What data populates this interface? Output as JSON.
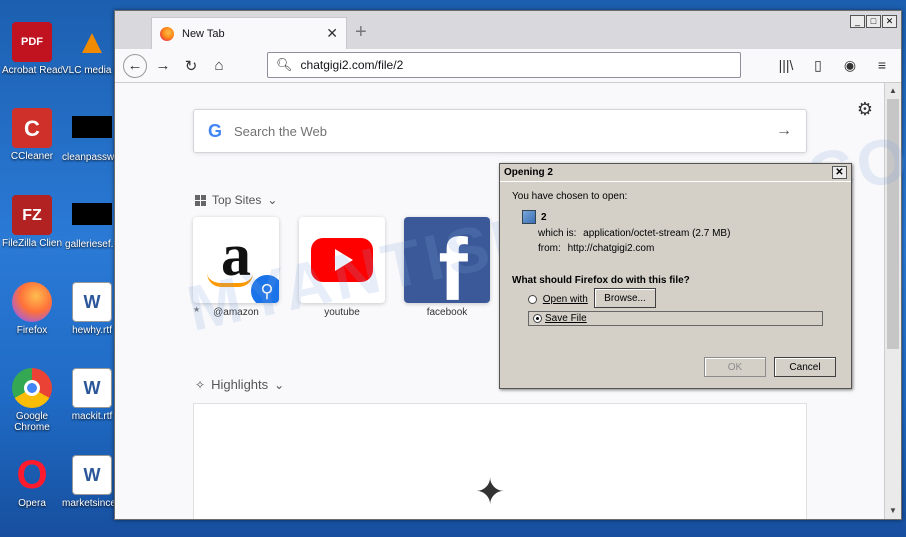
{
  "desktop": {
    "icons": [
      {
        "label": "Acrobat Reader DC",
        "color": "#c1121f",
        "glyph": "PDF"
      },
      {
        "label": "VLC media player",
        "color": "#f08a00",
        "glyph": "▲"
      },
      {
        "label": "CCleaner",
        "color": "#d0302a",
        "glyph": "C"
      },
      {
        "label": "cleanpassw...",
        "color": "#000000",
        "glyph": ""
      },
      {
        "label": "FileZilla Client",
        "color": "#b22222",
        "glyph": "FZ"
      },
      {
        "label": "galleriesef...",
        "color": "#000000",
        "glyph": ""
      },
      {
        "label": "Firefox",
        "color": "#ff7139",
        "glyph": "●"
      },
      {
        "label": "hewhy.rtf",
        "color": "#ffffff",
        "glyph": "W"
      },
      {
        "label": "Google Chrome",
        "color": "#4285f4",
        "glyph": "◉"
      },
      {
        "label": "mackit.rtf",
        "color": "#ffffff",
        "glyph": "W"
      },
      {
        "label": "Opera",
        "color": "#ff1b2d",
        "glyph": "O"
      },
      {
        "label": "marketsince...",
        "color": "#ffffff",
        "glyph": "W"
      }
    ]
  },
  "browser": {
    "tab_title": "New Tab",
    "tab_close": "✕",
    "new_tab": "+",
    "url": "chatgigi2.com/file/2",
    "toolbar_icons": [
      "back-icon",
      "forward-icon",
      "reload-icon",
      "home-icon",
      "library-icon",
      "sidebar-icon",
      "account-icon",
      "menu-icon"
    ]
  },
  "newtab": {
    "search_placeholder": "Search the Web",
    "top_sites_label": "Top Sites",
    "highlights_label": "Highlights",
    "sites": [
      {
        "label": "@amazon"
      },
      {
        "label": "youtube"
      },
      {
        "label": "facebook"
      }
    ]
  },
  "dialog": {
    "title": "Opening 2",
    "chosen_text": "You have chosen to open:",
    "file_name": "2",
    "which_is_label": "which is:",
    "which_is_value": "application/octet-stream (2.7 MB)",
    "from_label": "from:",
    "from_value": "http://chatgigi2.com",
    "question": "What should Firefox do with this file?",
    "open_with_label": "Open with",
    "browse_label": "Browse...",
    "save_file_label": "Save File",
    "ok_label": "OK",
    "cancel_label": "Cancel"
  },
  "watermark": "MYANTISPYWARE.COM"
}
